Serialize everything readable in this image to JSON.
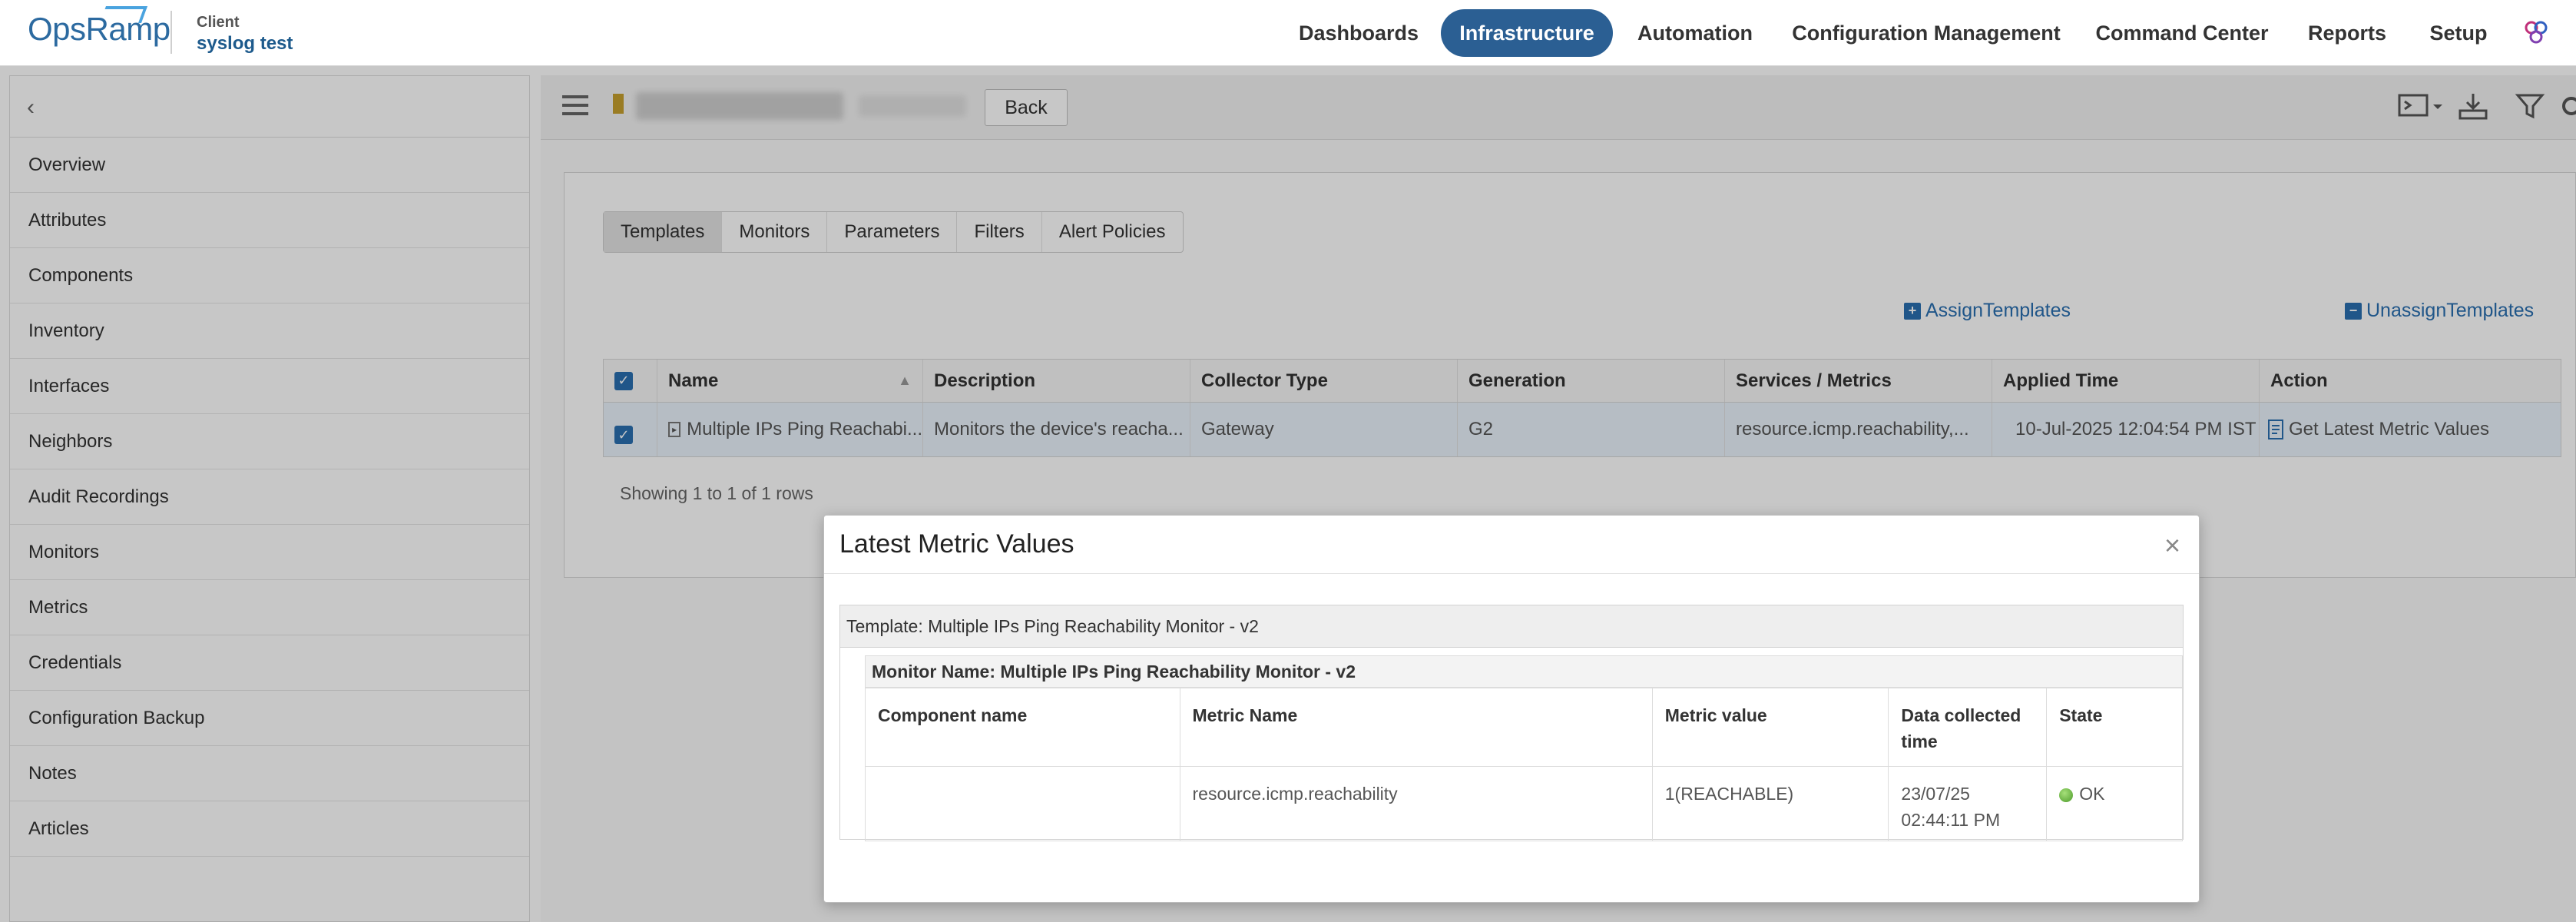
{
  "brand": {
    "logo": "OpsRamp",
    "client_label": "Client",
    "client_name": "syslog test"
  },
  "nav": {
    "items": [
      "Dashboards",
      "Infrastructure",
      "Automation",
      "Configuration Management",
      "Command Center",
      "Reports",
      "Setup"
    ],
    "active": "Infrastructure"
  },
  "sidebar": {
    "items": [
      "Overview",
      "Attributes",
      "Components",
      "Inventory",
      "Interfaces",
      "Neighbors",
      "Audit Recordings",
      "Monitors",
      "Metrics",
      "Credentials",
      "Configuration Backup",
      "Notes",
      "Articles"
    ]
  },
  "toolbar": {
    "back_label": "Back"
  },
  "tabs": [
    "Templates",
    "Monitors",
    "Parameters",
    "Filters",
    "Alert Policies"
  ],
  "actions": {
    "assign": "AssignTemplates",
    "unassign": "UnassignTemplates"
  },
  "grid": {
    "headers": [
      "Name",
      "Description",
      "Collector Type",
      "Generation",
      "Services / Metrics",
      "Applied Time",
      "Action"
    ],
    "rows": [
      {
        "name": "Multiple IPs Ping Reachabi...",
        "description": "Monitors the device's reacha...",
        "collector_type": "Gateway",
        "generation": "G2",
        "services_metrics": "resource.icmp.reachability,...",
        "applied_time": "10-Jul-2025 12:04:54 PM IST",
        "action": "Get Latest Metric Values"
      }
    ],
    "showing": "Showing 1 to 1 of 1 rows"
  },
  "modal": {
    "title": "Latest Metric Values",
    "template_line": "Template: Multiple IPs Ping Reachability Monitor - v2",
    "monitor_line": "Monitor Name: Multiple IPs Ping Reachability Monitor - v2",
    "headers": [
      "Component name",
      "Metric Name",
      "Metric value",
      "Data collected time",
      "State"
    ],
    "rows": [
      {
        "component": "",
        "metric_name": "resource.icmp.reachability",
        "metric_value": "1(REACHABLE)",
        "time_line1": "23/07/25",
        "time_line2": "02:44:11 PM",
        "state": "OK"
      }
    ]
  },
  "colors": {
    "primary": "#2b5f93",
    "link": "#2a6fb0",
    "ok": "#4c9a2a"
  }
}
